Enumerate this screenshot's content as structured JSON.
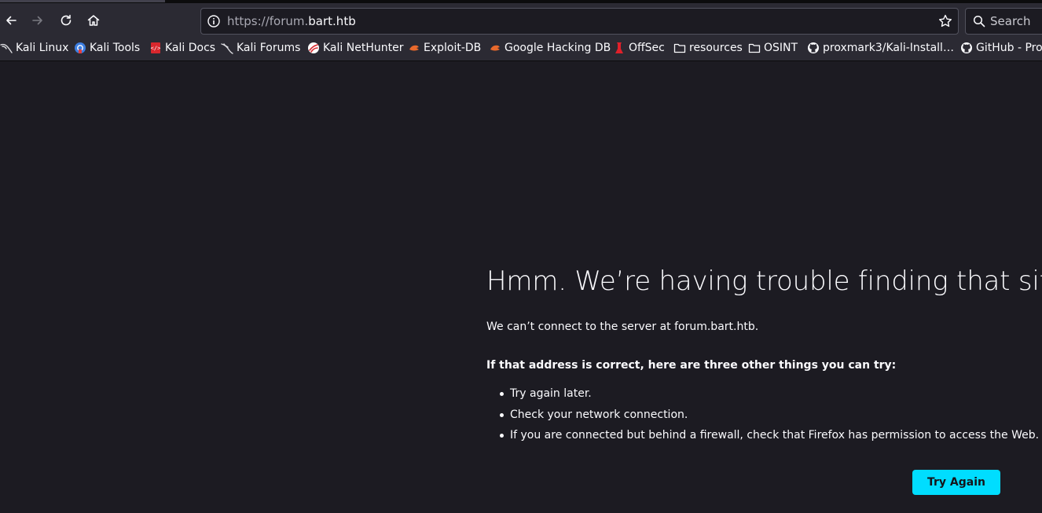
{
  "browser": {
    "url_prefix": "https://forum.",
    "url_host": "bart.htb",
    "search_placeholder": "Search",
    "nav_icons": [
      "back-icon",
      "forward-icon",
      "reload-icon",
      "home-icon"
    ]
  },
  "bookmarks": [
    {
      "label": "Kali Linux",
      "icon": "kali-dragon-icon"
    },
    {
      "label": "Kali Tools",
      "icon": "kali-tools-icon"
    },
    {
      "label": "Kali Docs",
      "icon": "kali-docs-icon"
    },
    {
      "label": "Kali Forums",
      "icon": "kali-dragon-icon"
    },
    {
      "label": "Kali NetHunter",
      "icon": "nethunter-icon"
    },
    {
      "label": "Exploit-DB",
      "icon": "exploit-db-icon"
    },
    {
      "label": "Google Hacking DB",
      "icon": "exploit-db-icon"
    },
    {
      "label": "OffSec",
      "icon": "offsec-icon"
    },
    {
      "label": "resources",
      "icon": "folder-icon"
    },
    {
      "label": "OSINT",
      "icon": "folder-icon"
    },
    {
      "label": "proxmark3/Kali-Install…",
      "icon": "github-icon"
    },
    {
      "label": "GitHub - Pro",
      "icon": "github-icon"
    }
  ],
  "error": {
    "title": "Hmm. We’re having trouble finding that site.",
    "description": "We can’t connect to the server at forum.bart.htb.",
    "subtitle": "If that address is correct, here are three other things you can try:",
    "suggestions": [
      "Try again later.",
      "Check your network connection.",
      "If you are connected but behind a firewall, check that Firefox has permission to access the Web."
    ],
    "button_label": "Try Again"
  },
  "colors": {
    "toolbar": "#2b2a33",
    "page_background": "#1c1b22",
    "accent_button": "#00ddff",
    "text": "#fbfbfe"
  }
}
